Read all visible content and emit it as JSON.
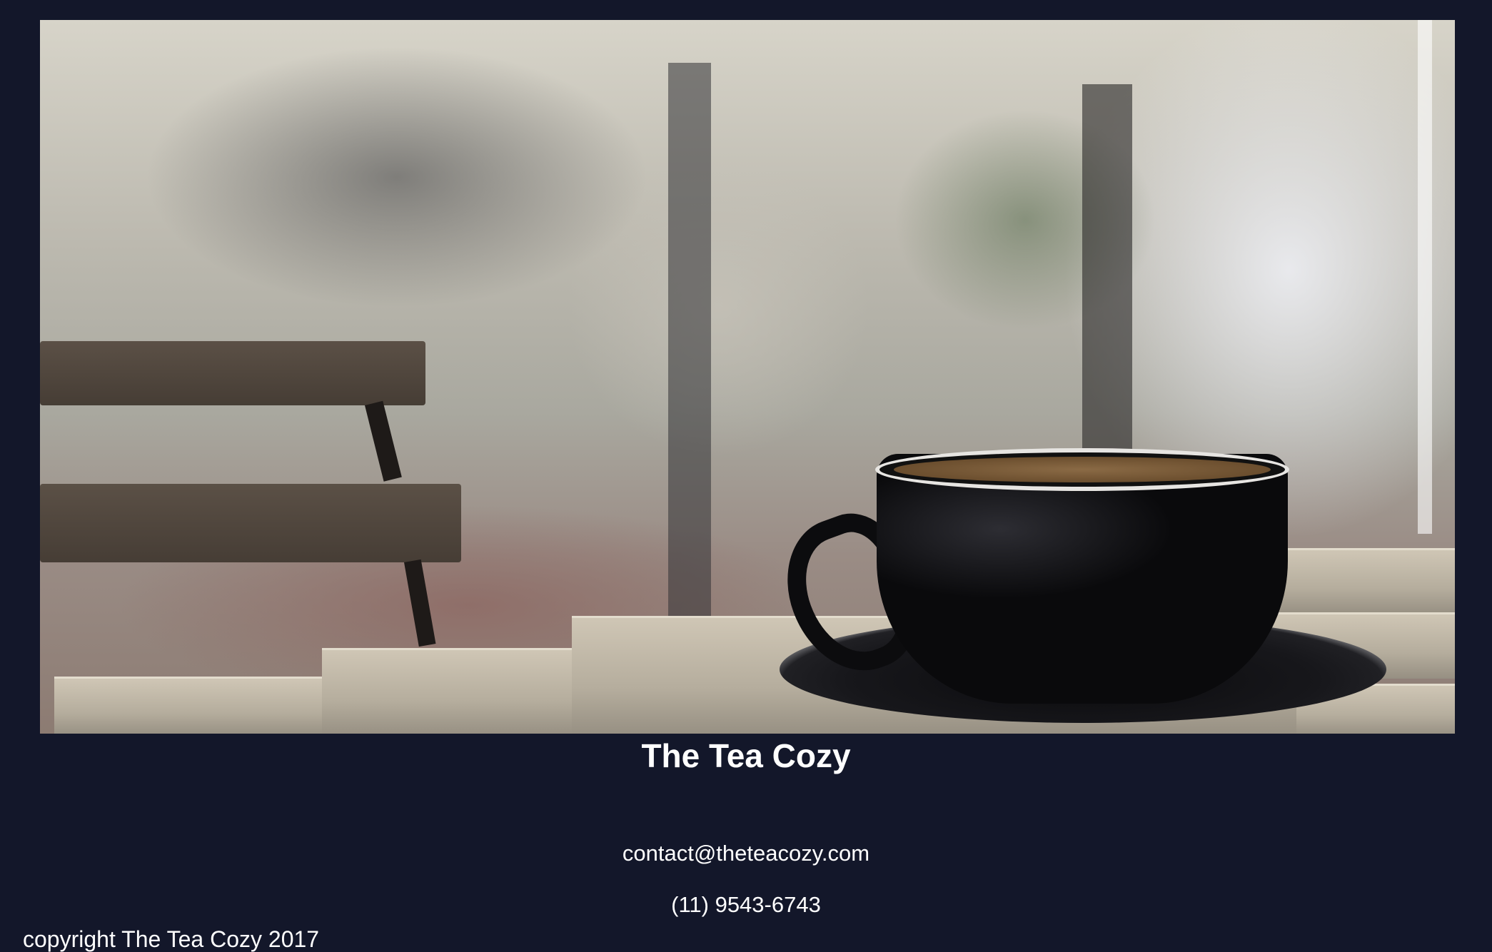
{
  "header": {
    "hero_image": "coffee-cup-on-table-photo"
  },
  "main": {
    "title": "The Tea Cozy"
  },
  "contact": {
    "email": "contact@theteacozy.com",
    "phone": "(11) 9543-6743"
  },
  "footer": {
    "copyright": "copyright The Tea Cozy 2017"
  },
  "colors": {
    "background": "#13172a",
    "text": "#ffffff"
  }
}
